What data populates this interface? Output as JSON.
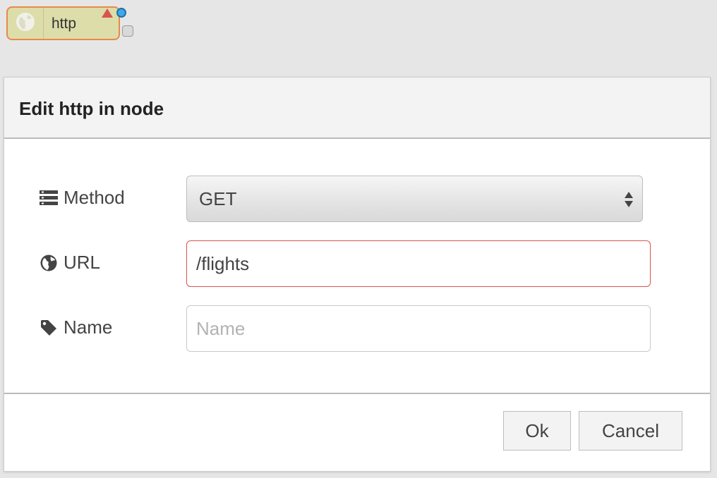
{
  "node": {
    "label": "http",
    "icon": "globe-icon",
    "fill": "#ddddaa",
    "border": "#e68a4c"
  },
  "dialog": {
    "title": "Edit http in node",
    "fields": {
      "method": {
        "label": "Method",
        "icon": "list-icon",
        "value": "GET"
      },
      "url": {
        "label": "URL",
        "icon": "globe-icon",
        "value": "/flights",
        "status": "invalid"
      },
      "name": {
        "label": "Name",
        "icon": "tag-icon",
        "value": "",
        "placeholder": "Name"
      }
    },
    "buttons": {
      "ok": "Ok",
      "cancel": "Cancel"
    }
  },
  "colors": {
    "invalid_border": "#d9534f",
    "changed_indicator": "#3fa9e8",
    "error_indicator": "#d9534f"
  }
}
